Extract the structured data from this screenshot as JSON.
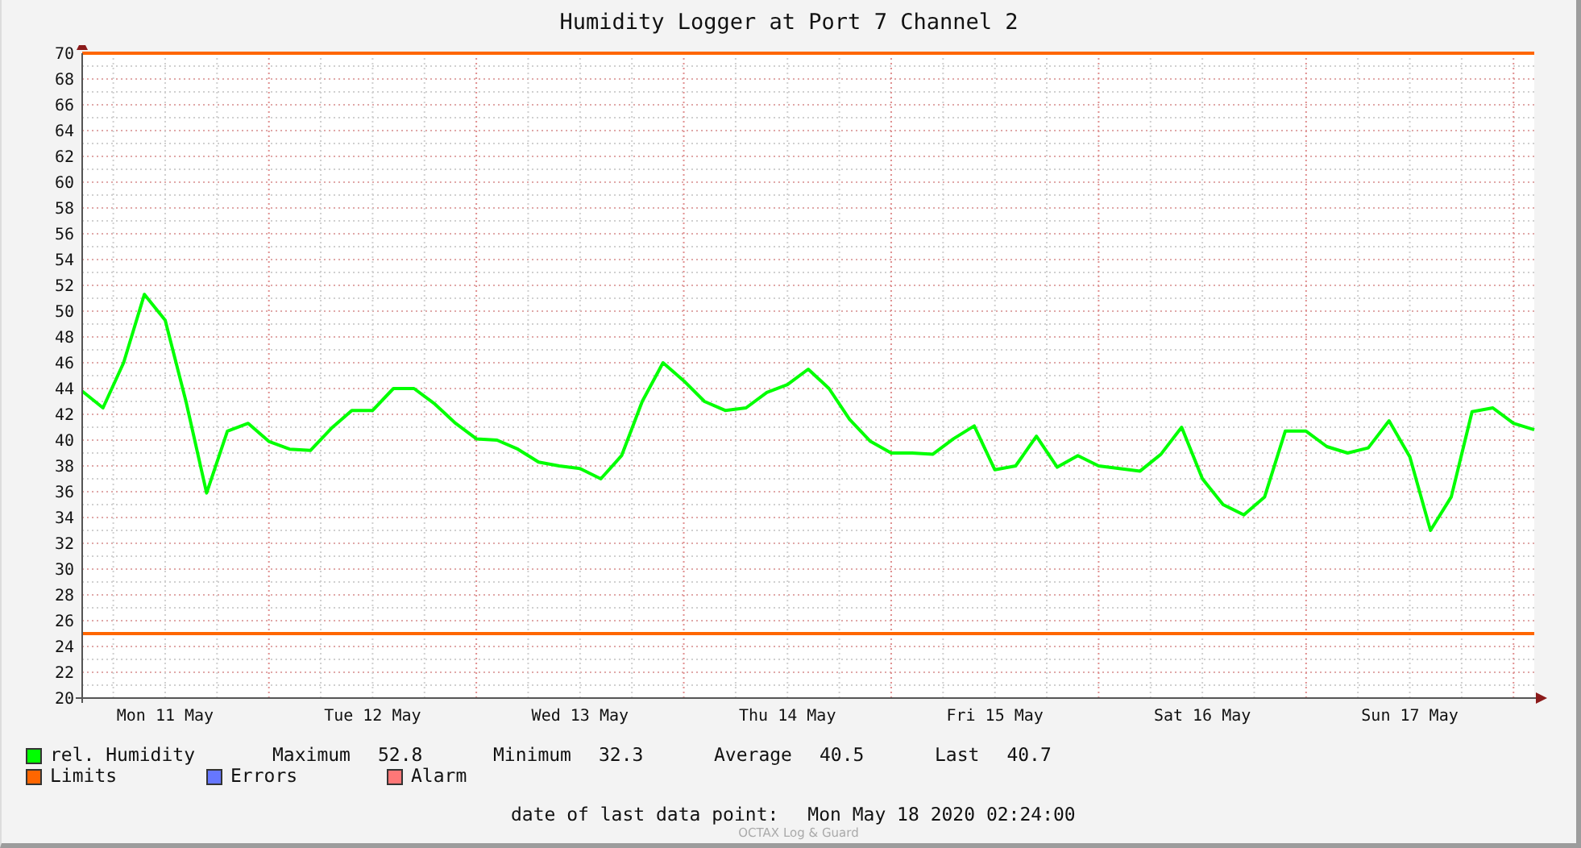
{
  "chart_data": {
    "type": "line",
    "title": "Humidity Logger at Port 7 Channel 2",
    "ylim": [
      20,
      70
    ],
    "categories": [
      null,
      null,
      null,
      null,
      "Mon 11 May",
      null,
      null,
      null,
      null,
      null,
      null,
      null,
      null,
      null,
      "Tue 12 May",
      null,
      null,
      null,
      null,
      null,
      null,
      null,
      null,
      null,
      "Wed 13 May",
      null,
      null,
      null,
      null,
      null,
      null,
      null,
      null,
      null,
      "Thu 14 May",
      null,
      null,
      null,
      null,
      null,
      null,
      null,
      null,
      null,
      "Fri 15 May",
      null,
      null,
      null,
      null,
      null,
      null,
      null,
      null,
      null,
      "Sat 16 May",
      null,
      null,
      null,
      null,
      null,
      null,
      null,
      null,
      null,
      "Sun 17 May",
      null,
      null,
      null,
      null,
      null,
      null
    ],
    "series": [
      {
        "name": "rel. Humidity",
        "color": "#00ff00",
        "values": [
          43.8,
          42.5,
          46,
          51.3,
          49.3,
          43,
          35.9,
          40.7,
          41.3,
          39.9,
          39.3,
          39.2,
          40.9,
          42.3,
          42.3,
          44,
          44,
          42.8,
          41.3,
          40.1,
          40,
          39.3,
          38.3,
          38,
          37.8,
          37,
          38.8,
          43,
          46,
          44.6,
          43,
          42.3,
          42.5,
          43.7,
          44.3,
          45.5,
          44,
          41.6,
          39.9,
          39,
          39,
          38.9,
          40.1,
          41.1,
          37.7,
          38,
          40.3,
          37.9,
          38.8,
          38,
          37.8,
          37.6,
          38.9,
          41,
          37,
          35,
          34.2,
          35.6,
          40.7,
          40.7,
          39.5,
          39,
          39.4,
          41.5,
          38.7,
          33,
          35.6,
          42.2,
          42.5,
          41.3,
          40.8
        ]
      },
      {
        "name": "Limits",
        "color": "#ff6600",
        "values": [
          70,
          70,
          70,
          70,
          70,
          70,
          70,
          70,
          70,
          70,
          70,
          70,
          70,
          70,
          70,
          70,
          70,
          70,
          70,
          70,
          70,
          70,
          70,
          70,
          70,
          70,
          70,
          70,
          70,
          70,
          70,
          70,
          70,
          70,
          70,
          70,
          70,
          70,
          70,
          70,
          70,
          70,
          70,
          70,
          70,
          70,
          70,
          70,
          70,
          70,
          70,
          70,
          70,
          70,
          70,
          70,
          70,
          70,
          70,
          70,
          70,
          70,
          70,
          70,
          70,
          70,
          70,
          70,
          70,
          70,
          70
        ]
      },
      {
        "color": "#ff6600",
        "values": [
          25,
          25,
          25,
          25,
          25,
          25,
          25,
          25,
          25,
          25,
          25,
          25,
          25,
          25,
          25,
          25,
          25,
          25,
          25,
          25,
          25,
          25,
          25,
          25,
          25,
          25,
          25,
          25,
          25,
          25,
          25,
          25,
          25,
          25,
          25,
          25,
          25,
          25,
          25,
          25,
          25,
          25,
          25,
          25,
          25,
          25,
          25,
          25,
          25,
          25,
          25,
          25,
          25,
          25,
          25,
          25,
          25,
          25,
          25,
          25,
          25,
          25,
          25,
          25,
          25,
          25,
          25,
          25,
          25,
          25,
          25
        ]
      }
    ],
    "yticks": [
      20,
      22,
      24,
      26,
      28,
      30,
      32,
      34,
      36,
      38,
      40,
      42,
      44,
      46,
      48,
      50,
      52,
      54,
      56,
      58,
      60,
      62,
      64,
      66,
      68,
      70
    ],
    "grid": true
  },
  "legend": [
    [
      {
        "kind": "series",
        "stats": [
          {
            "label": "Maximum",
            "value": "52.8"
          },
          {
            "label": "Minimum",
            "value": "32.3"
          },
          {
            "label": "Average",
            "value": "40.5"
          },
          {
            "label": "Last",
            "value": "40.7"
          }
        ]
      }
    ],
    [
      {
        "kind": "series"
      },
      {
        "kind": "plain",
        "label": "Errors",
        "color": "#6677ff"
      },
      {
        "kind": "plain",
        "label": "Alarm",
        "color": "#ff7777"
      }
    ]
  ],
  "footer": {
    "label": "date of last data point:",
    "value": "Mon May 18 2020 02:24:00",
    "watermark": "OCTAX Log & Guard"
  }
}
